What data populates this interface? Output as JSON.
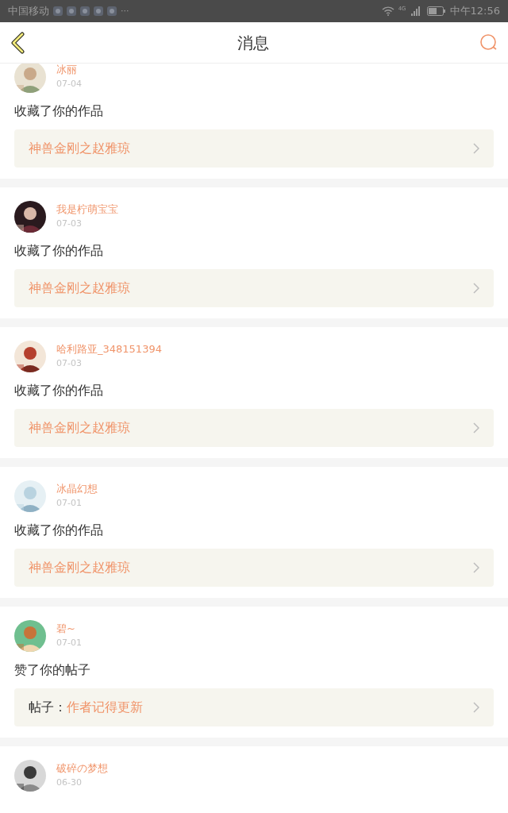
{
  "status_bar": {
    "carrier": "中国移动",
    "more": "···",
    "network": "4G",
    "time": "中午12:56"
  },
  "header": {
    "title": "消息"
  },
  "messages": [
    {
      "user": "冰丽",
      "date": "07-04",
      "action": "收藏了你的作品",
      "target": {
        "title": "神兽金刚之赵雅琼"
      }
    },
    {
      "user": "我是柠萌宝宝",
      "date": "07-03",
      "action": "收藏了你的作品",
      "target": {
        "title": "神兽金刚之赵雅琼"
      }
    },
    {
      "user": "哈利路亚_348151394",
      "date": "07-03",
      "action": "收藏了你的作品",
      "target": {
        "title": "神兽金刚之赵雅琼"
      }
    },
    {
      "user": "冰晶幻想",
      "date": "07-01",
      "action": "收藏了你的作品",
      "target": {
        "title": "神兽金刚之赵雅琼"
      }
    },
    {
      "user": "碧~",
      "date": "07-01",
      "action": "赞了你的帖子",
      "target": {
        "prefix": "帖子：",
        "title": "作者记得更新"
      }
    },
    {
      "user": "破碎の梦想",
      "date": "06-30"
    }
  ]
}
